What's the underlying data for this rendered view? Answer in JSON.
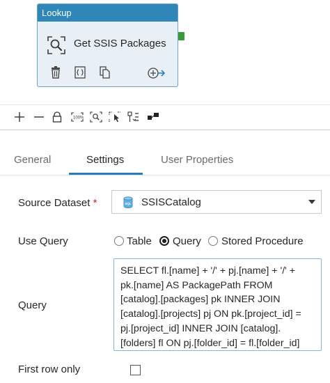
{
  "activity": {
    "type_label": "Lookup",
    "name": "Get SSIS Packages",
    "icons": [
      "search-icon",
      "delete-icon",
      "code-icon",
      "copy-icon",
      "add-output-icon"
    ]
  },
  "toolbar": {
    "icons": [
      "add-icon",
      "remove-icon",
      "lock-icon",
      "zoom-100-icon",
      "zoom-fit-icon",
      "select-icon",
      "auto-align-icon",
      "layout-icon"
    ]
  },
  "tabs": [
    {
      "label": "General",
      "active": false
    },
    {
      "label": "Settings",
      "active": true
    },
    {
      "label": "User Properties",
      "active": false
    }
  ],
  "settings": {
    "source_dataset_label": "Source Dataset",
    "required_mark": "*",
    "source_dataset_value": "SSISCatalog",
    "use_query_label": "Use Query",
    "use_query_options": [
      "Table",
      "Query",
      "Stored Procedure"
    ],
    "use_query_selected": "Query",
    "query_label": "Query",
    "query_text": "SELECT fl.[name] + '/' + pj.[name] + '/' +\npk.[name] AS PackagePath FROM\n[catalog].[packages] pk INNER JOIN\n[catalog].[projects] pj ON pk.[project_id] =\npj.[project_id] INNER JOIN [catalog].\n[folders] fl ON pj.[folder_id] = fl.[folder_id]",
    "first_row_only_label": "First row only",
    "first_row_only_checked": false
  },
  "colors": {
    "header_blue": "#2f86b8",
    "accent": "#2b7bb9",
    "success": "#3a9a3a",
    "required": "#c4262e"
  }
}
